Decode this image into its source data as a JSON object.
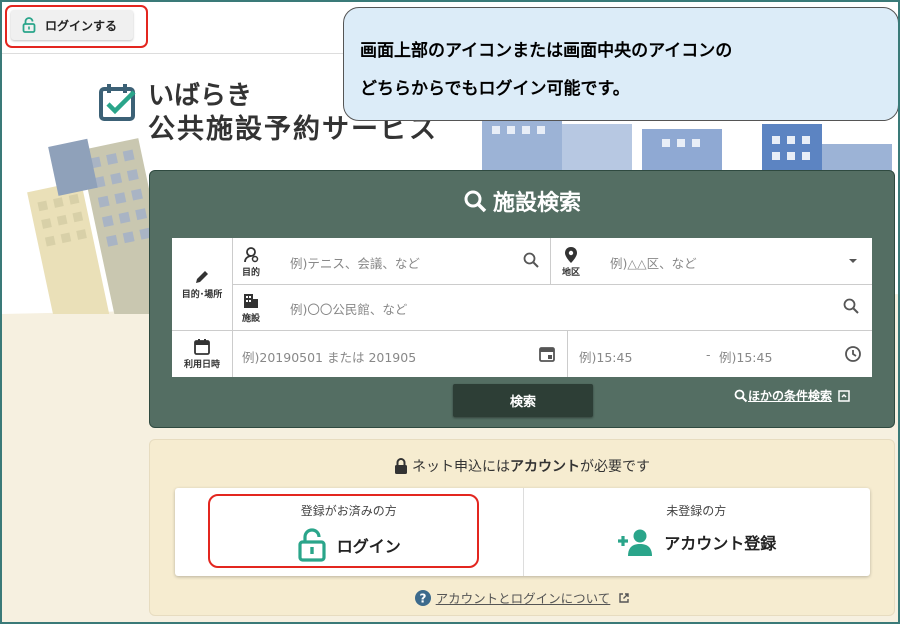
{
  "header": {
    "login_button_label": "ログインする"
  },
  "callout": {
    "line1": "画面上部のアイコンまたは画面中央のアイコンの",
    "line2": "どちらからでもログイン可能です。"
  },
  "logo": {
    "line1": "いばらき",
    "line2": "公共施設予約サービス"
  },
  "search": {
    "title": "施設検索",
    "purpose_place_label": "目的･場所",
    "purpose_label": "目的",
    "purpose_placeholder": "例)テニス、会議、など",
    "area_label": "地区",
    "area_placeholder": "例)△△区、など",
    "facility_label": "施設",
    "facility_placeholder": "例)〇〇公民館、など",
    "datetime_label": "利用日時",
    "date_placeholder": "例)20190501 または 201905",
    "time_from_placeholder": "例)15:45",
    "time_sep": "-",
    "time_to_placeholder": "例)15:45",
    "search_button": "検索",
    "other_conditions": "ほかの条件検索"
  },
  "account": {
    "notice_pre": "ネット申込には",
    "notice_bold": "アカウント",
    "notice_post": "が必要です",
    "registered_title": "登録がお済みの方",
    "login_label": "ログイン",
    "unregistered_title": "未登録の方",
    "register_label": "アカウント登録",
    "about_link": "アカウントとログインについて"
  },
  "colors": {
    "accent_teal": "#2aa58a",
    "panel_green": "#546e63",
    "highlight_red": "#e3261f",
    "callout_blue": "#dcecf8"
  }
}
